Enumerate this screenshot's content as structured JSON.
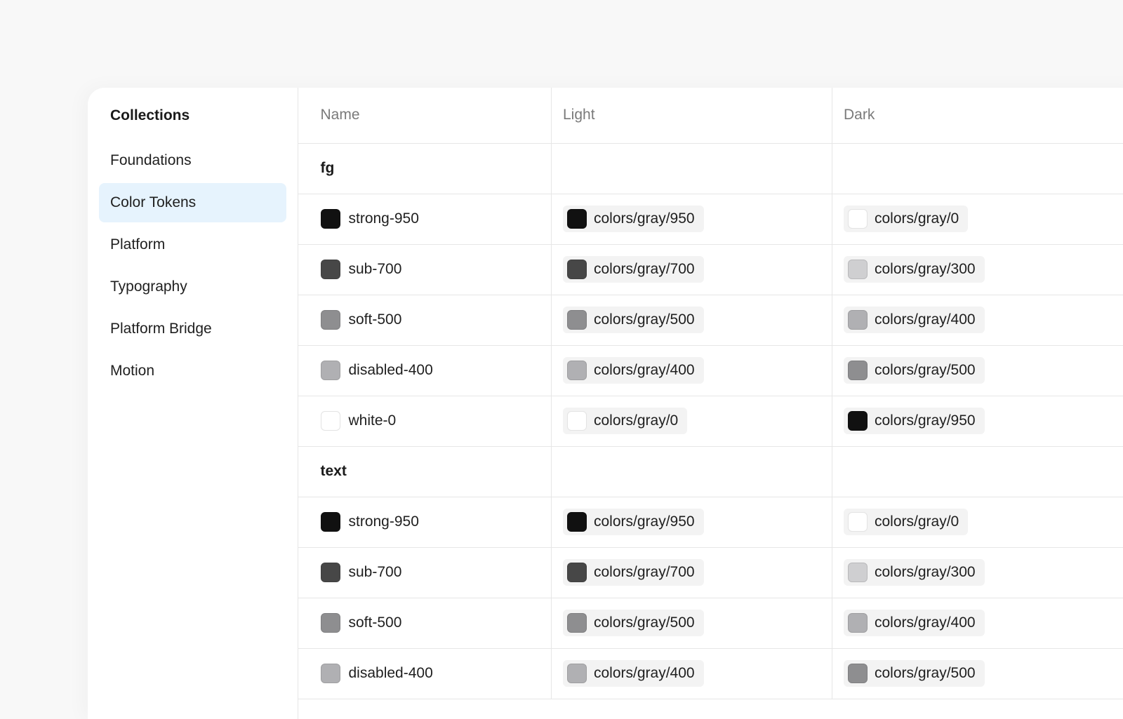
{
  "sidebar": {
    "title": "Collections",
    "items": [
      {
        "label": "Foundations",
        "active": false
      },
      {
        "label": "Color Tokens",
        "active": true
      },
      {
        "label": "Platform",
        "active": false
      },
      {
        "label": "Typography",
        "active": false
      },
      {
        "label": "Platform Bridge",
        "active": false
      },
      {
        "label": "Motion",
        "active": false
      }
    ]
  },
  "table": {
    "headers": {
      "name": "Name",
      "light": "Light",
      "dark": "Dark"
    },
    "groups": [
      {
        "label": "fg",
        "rows": [
          {
            "name": "strong-950",
            "swatch": "#111111",
            "light": {
              "label": "colors/gray/950",
              "color": "#111111"
            },
            "dark": {
              "label": "colors/gray/0",
              "color": "#ffffff"
            }
          },
          {
            "name": "sub-700",
            "swatch": "#474747",
            "light": {
              "label": "colors/gray/700",
              "color": "#474747"
            },
            "dark": {
              "label": "colors/gray/300",
              "color": "#cfcfd1"
            }
          },
          {
            "name": "soft-500",
            "swatch": "#8e8e90",
            "light": {
              "label": "colors/gray/500",
              "color": "#8e8e90"
            },
            "dark": {
              "label": "colors/gray/400",
              "color": "#b0b0b3"
            }
          },
          {
            "name": "disabled-400",
            "swatch": "#b0b0b3",
            "light": {
              "label": "colors/gray/400",
              "color": "#b0b0b3"
            },
            "dark": {
              "label": "colors/gray/500",
              "color": "#8e8e90"
            }
          },
          {
            "name": "white-0",
            "swatch": "#ffffff",
            "light": {
              "label": "colors/gray/0",
              "color": "#ffffff"
            },
            "dark": {
              "label": "colors/gray/950",
              "color": "#111111"
            }
          }
        ]
      },
      {
        "label": "text",
        "rows": [
          {
            "name": "strong-950",
            "swatch": "#111111",
            "light": {
              "label": "colors/gray/950",
              "color": "#111111"
            },
            "dark": {
              "label": "colors/gray/0",
              "color": "#ffffff"
            }
          },
          {
            "name": "sub-700",
            "swatch": "#474747",
            "light": {
              "label": "colors/gray/700",
              "color": "#474747"
            },
            "dark": {
              "label": "colors/gray/300",
              "color": "#cfcfd1"
            }
          },
          {
            "name": "soft-500",
            "swatch": "#8e8e90",
            "light": {
              "label": "colors/gray/500",
              "color": "#8e8e90"
            },
            "dark": {
              "label": "colors/gray/400",
              "color": "#b0b0b3"
            }
          },
          {
            "name": "disabled-400",
            "swatch": "#b0b0b3",
            "light": {
              "label": "colors/gray/400",
              "color": "#b0b0b3"
            },
            "dark": {
              "label": "colors/gray/500",
              "color": "#8e8e90"
            }
          }
        ]
      }
    ]
  },
  "colors": {
    "active_item_bg": "#e6f3fd",
    "chip_bg": "#f3f3f3",
    "border": "#e6e6e6",
    "header_text": "#7a7a7a"
  }
}
